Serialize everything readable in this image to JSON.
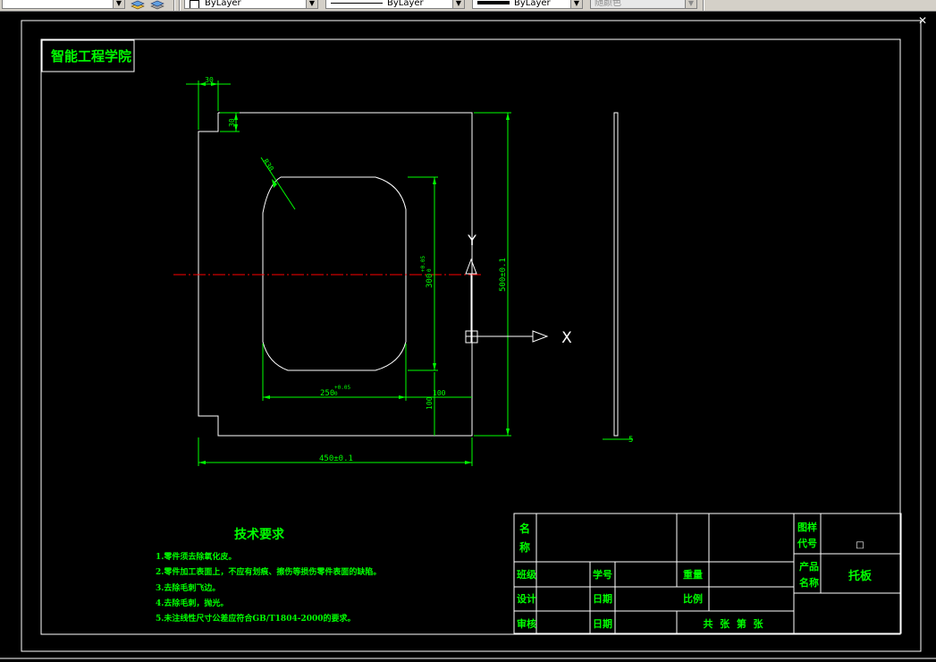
{
  "toolbar": {
    "layer_combo": "",
    "color_combo": "ByLayer",
    "linetype_combo": "ByLayer",
    "lineweight_combo": "ByLayer",
    "plotstyle_combo": "随颜色"
  },
  "drawing": {
    "school_name": "智能工程学院",
    "dimensions": {
      "top_notch_width": "30",
      "top_notch_height": "30",
      "fillet_radius": "R30",
      "pocket_height": "300",
      "pocket_height_tol_upper": "+0.05",
      "pocket_height_tol_lower": "0",
      "overall_height": "500±0.1",
      "pocket_width": "250",
      "pocket_width_tol_upper": "+0.05",
      "pocket_width_tol_lower": "0",
      "offset_x": "100",
      "offset_y": "100",
      "overall_width": "450±0.1",
      "thickness": "5"
    },
    "ucs": {
      "x_label": "X",
      "y_label": "Y"
    },
    "tech_requirements": {
      "title": "技术要求",
      "items": [
        "1.零件须去除氧化皮。",
        "2.零件加工表面上，不应有划痕、擦伤等损伤零件表面的缺陷。",
        "3.去除毛刺飞边。",
        "4.去除毛刺，抛光。",
        "5.未注线性尺寸公差应符合GB/T1804-2000的要求。"
      ]
    },
    "title_block": {
      "name_label": "名称",
      "drawing_no_label": "图样代号",
      "drawing_no_value": "□",
      "class_label": "班级",
      "student_id_label": "学号",
      "weight_label": "重量",
      "product_label": "产品名称",
      "product_value": "托板",
      "design_label": "设计",
      "date_label": "日期",
      "scale_label": "比例",
      "review_label": "审核",
      "date2_label": "日期",
      "sheets_label": "共  张  第  张"
    }
  },
  "colors": {
    "outline": "#ffffff",
    "dimension": "#00ff00",
    "centerline": "#ff0000",
    "background": "#000000"
  }
}
